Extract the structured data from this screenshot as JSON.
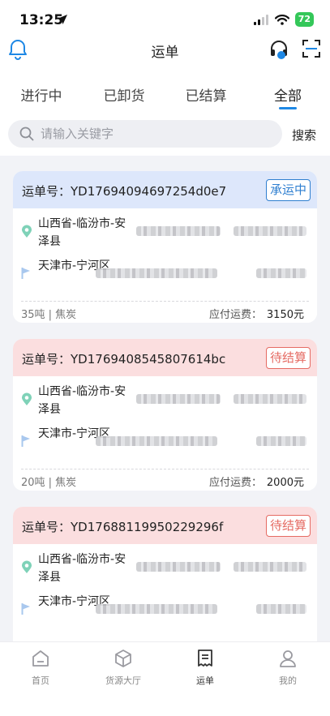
{
  "status_bar": {
    "time": "13:25",
    "battery": "72"
  },
  "nav": {
    "title": "运单"
  },
  "tabs": [
    {
      "label": "进行中"
    },
    {
      "label": "已卸货"
    },
    {
      "label": "已结算"
    },
    {
      "label": "全部",
      "active": true
    }
  ],
  "search": {
    "placeholder": "请输入关键字",
    "button": "搜索"
  },
  "orders": [
    {
      "order_label": "运单号：",
      "order_no": "YD17694094697254d0e7",
      "status": "承运中",
      "status_color": "#2f7fd0",
      "origin": "山西省-临汾市-安泽县",
      "destination": "天津市-宁河区",
      "cargo": "35吨 | 焦炭",
      "fee_label": "应付运费：",
      "fee": "3150元"
    },
    {
      "order_label": "运单号：",
      "order_no": "YD1769408545807614bc",
      "status": "待结算",
      "status_color": "#e56b63",
      "origin": "山西省-临汾市-安泽县",
      "destination": "天津市-宁河区",
      "cargo": "20吨 | 焦炭",
      "fee_label": "应付运费：",
      "fee": "2000元"
    },
    {
      "order_label": "运单号：",
      "order_no": "YD17688119950229296f",
      "status": "待结算",
      "status_color": "#e56b63",
      "origin": "山西省-临汾市-安泽县",
      "destination": "天津市-宁河区"
    }
  ],
  "tabbar": [
    {
      "label": "首页",
      "icon": "home-icon"
    },
    {
      "label": "货源大厅",
      "icon": "package-icon"
    },
    {
      "label": "运单",
      "icon": "waybill-icon",
      "active": true
    },
    {
      "label": "我的",
      "icon": "user-icon"
    }
  ],
  "colors": {
    "accent": "#1e88e5",
    "origin_pin": "#7fd2b8",
    "dest_flag": "#a9c8ee"
  }
}
